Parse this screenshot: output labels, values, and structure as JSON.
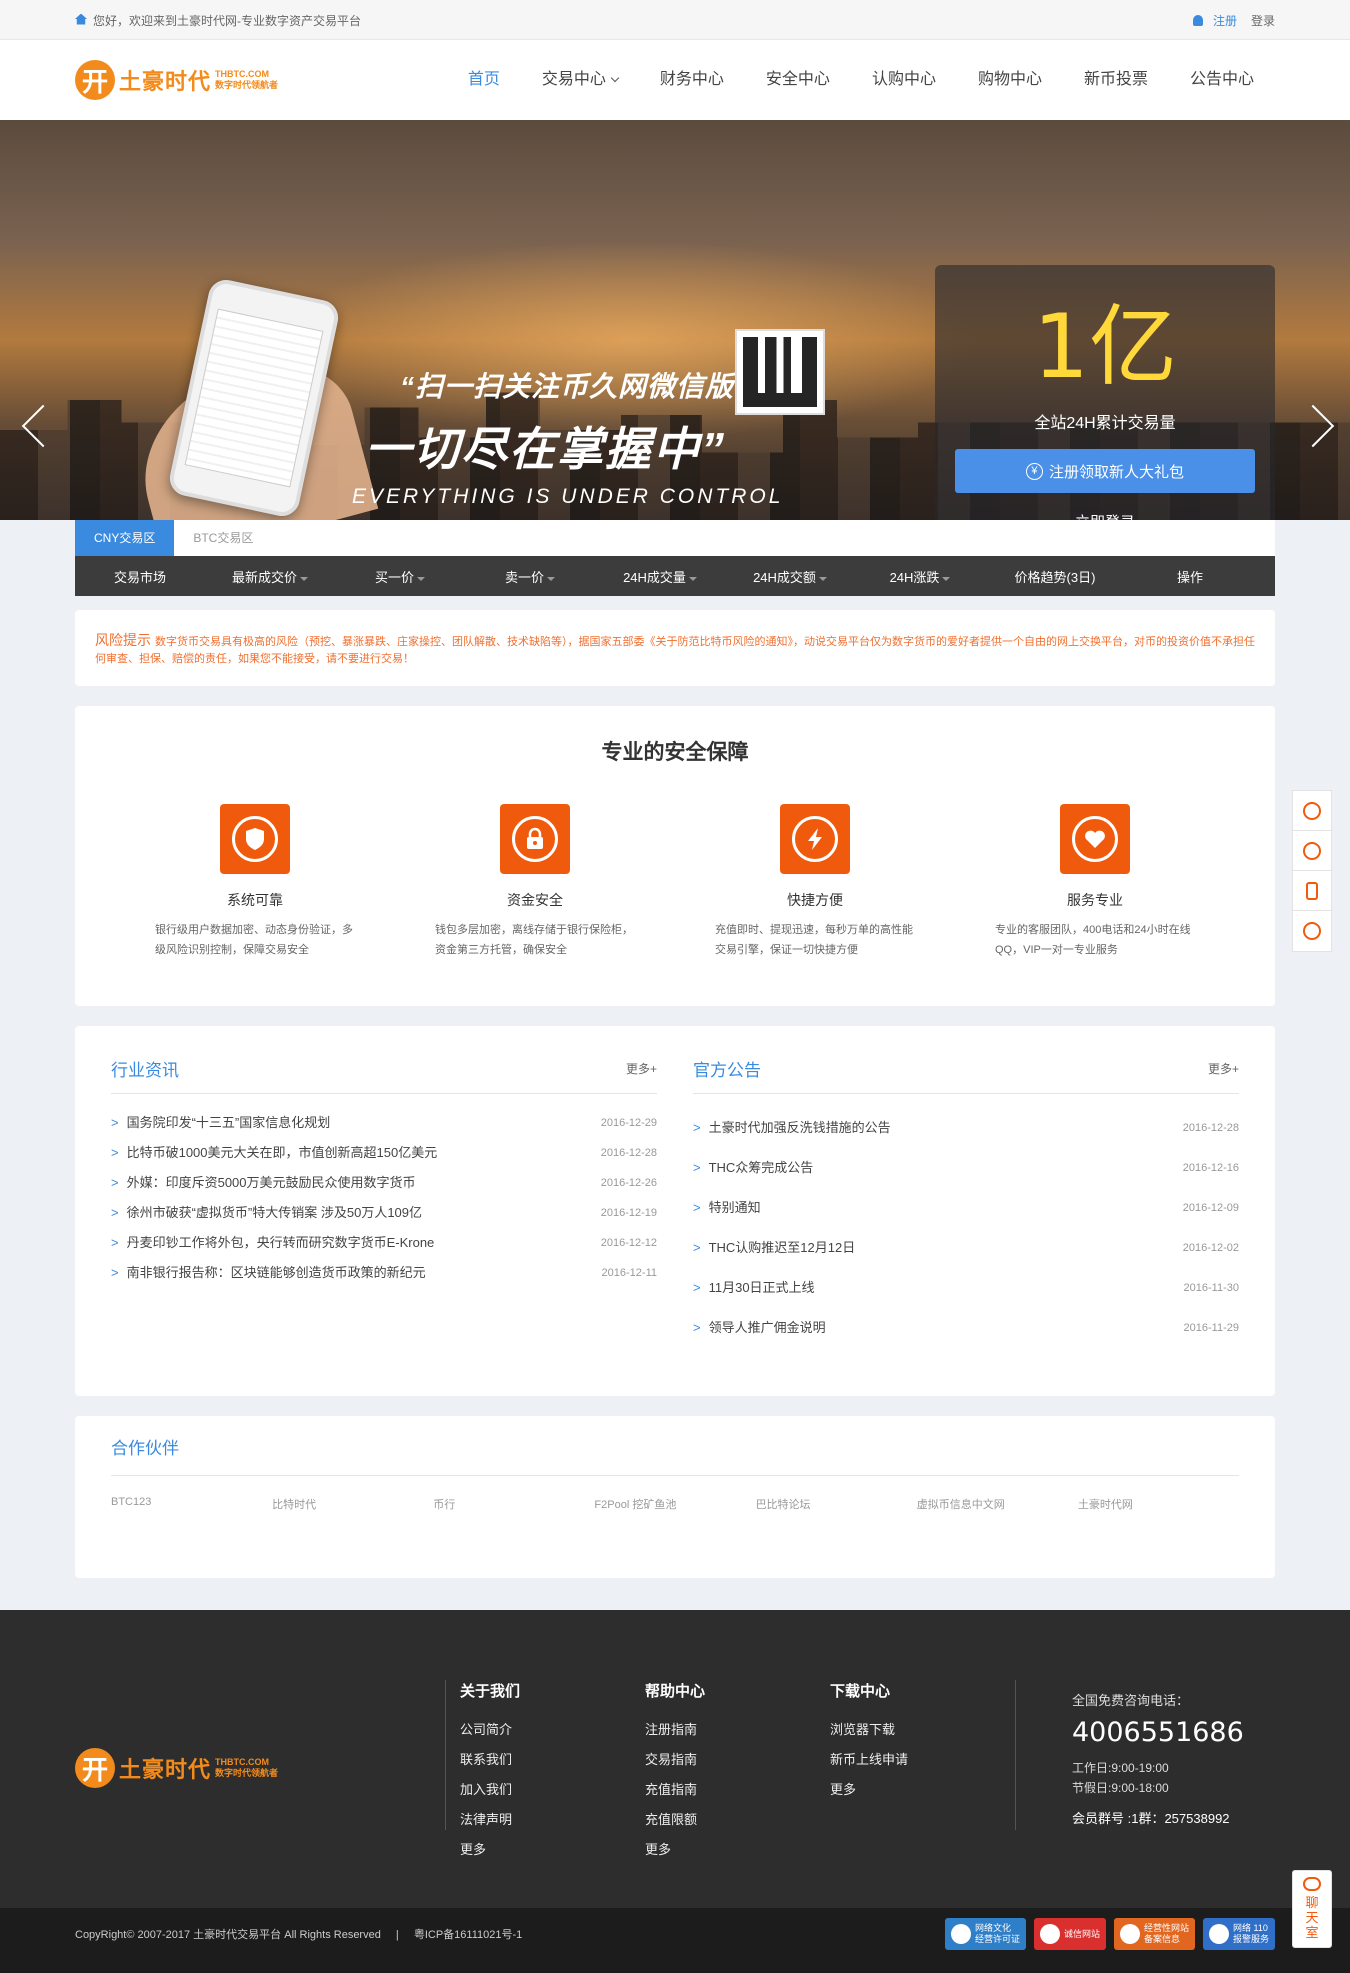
{
  "topbar": {
    "welcome": "您好，欢迎来到土豪时代网-专业数字资产交易平台",
    "register": "注册",
    "login": "登录"
  },
  "logo": {
    "mark": "开",
    "name": "土豪时代",
    "domain": "THBTC.COM",
    "tagline": "数字时代领航者"
  },
  "nav": [
    {
      "label": "首页",
      "active": true
    },
    {
      "label": "交易中心",
      "dropdown": true
    },
    {
      "label": "财务中心"
    },
    {
      "label": "安全中心"
    },
    {
      "label": "认购中心"
    },
    {
      "label": "购物中心"
    },
    {
      "label": "新币投票"
    },
    {
      "label": "公告中心"
    }
  ],
  "banner": {
    "line1": "“扫一扫关注币久网微信版",
    "line2": "一切尽在掌握中”",
    "line3": "EVERYTHING IS UNDER CONTROL",
    "volume": "1亿",
    "volume_label": "全站24H累计交易量",
    "cta": "注册领取新人大礼包",
    "yen": "¥",
    "login": "立即登录"
  },
  "market": {
    "tabs": [
      "CNY交易区",
      "BTC交易区"
    ],
    "columns": [
      "交易市场",
      "最新成交价",
      "买一价",
      "卖一价",
      "24H成交量",
      "24H成交额",
      "24H涨跌",
      "价格趋势(3日)",
      "操作"
    ]
  },
  "risk": {
    "title": "风险提示",
    "text": "数字货币交易具有极高的风险（预挖、暴涨暴跌、庄家操控、团队解散、技术缺陷等），据国家五部委《关于防范比特币风险的通知》，动说交易平台仅为数字货币的爱好者提供一个自由的网上交换平台，对币的投资价值不承担任何审查、担保、赔偿的责任，如果您不能接受，请不要进行交易！"
  },
  "security": {
    "title": "专业的安全保障",
    "features": [
      {
        "icon": "shield-icon",
        "title": "系统可靠",
        "desc": "银行级用户数据加密、动态身份验证，多级风险识别控制，保障交易安全"
      },
      {
        "icon": "lock-icon",
        "title": "资金安全",
        "desc": "钱包多层加密，离线存储于银行保险柜，资金第三方托管，确保安全"
      },
      {
        "icon": "lightning-icon",
        "title": "快捷方便",
        "desc": "充值即时、提现迅速，每秒万单的高性能交易引擎，保证一切快捷方便"
      },
      {
        "icon": "heart-icon",
        "title": "服务专业",
        "desc": "专业的客服团队，400电话和24小时在线QQ，VIP一对一专业服务"
      }
    ]
  },
  "news": {
    "title": "行业资讯",
    "more": "更多+",
    "items": [
      {
        "text": "国务院印发“十三五”国家信息化规划",
        "date": "2016-12-29"
      },
      {
        "text": "比特币破1000美元大关在即，市值创新高超150亿美元",
        "date": "2016-12-28"
      },
      {
        "text": "外媒：印度斥资5000万美元鼓励民众使用数字货币",
        "date": "2016-12-26"
      },
      {
        "text": "徐州市破获“虚拟货币”特大传销案 涉及50万人109亿",
        "date": "2016-12-19"
      },
      {
        "text": "丹麦印钞工作将外包，央行转而研究数字货币E-Krone",
        "date": "2016-12-12"
      },
      {
        "text": "南非银行报告称：区块链能够创造货币政策的新纪元",
        "date": "2016-12-11"
      }
    ]
  },
  "announcements": {
    "title": "官方公告",
    "more": "更多+",
    "items": [
      {
        "text": "土豪时代加强反洗钱措施的公告",
        "date": "2016-12-28"
      },
      {
        "text": "THC众筹完成公告",
        "date": "2016-12-16"
      },
      {
        "text": "特别通知",
        "date": "2016-12-09"
      },
      {
        "text": "THC认购推迟至12月12日",
        "date": "2016-12-02"
      },
      {
        "text": "11月30日正式上线",
        "date": "2016-11-30"
      },
      {
        "text": "领导人推广佣金说明",
        "date": "2016-11-29"
      }
    ]
  },
  "partners": {
    "title": "合作伙伴",
    "items": [
      "BTC123",
      "比特时代",
      "币行",
      "F2Pool 挖矿鱼池",
      "巴比特论坛",
      "虚拟币信息中文网",
      "土豪时代网"
    ]
  },
  "footer": {
    "cols": [
      {
        "title": "关于我们",
        "items": [
          "公司简介",
          "联系我们",
          "加入我们",
          "法律声明",
          "更多"
        ]
      },
      {
        "title": "帮助中心",
        "items": [
          "注册指南",
          "交易指南",
          "充值指南",
          "充值限额",
          "更多"
        ]
      },
      {
        "title": "下载中心",
        "items": [
          "浏览器下载",
          "新币上线申请",
          "更多"
        ]
      }
    ],
    "hotline_label": "全国免费咨询电话：",
    "hotline": "4006551686",
    "workday": "工作日:9:00-19:00",
    "holiday": "节假日:9:00-18:00",
    "qq": "会员群号 :1群：257538992",
    "copyright": "CopyRight© 2007-2017 土豪时代交易平台 All Rights Reserved",
    "sep": "|",
    "icp": "粤ICP备16111021号-1",
    "badges": [
      {
        "line1": "网络文化",
        "line2": "经营许可证",
        "color": "#2f7fc8"
      },
      {
        "line1": "诚信网站",
        "line2": "",
        "color": "#d9302f"
      },
      {
        "line1": "经营性网站",
        "line2": "备案信息",
        "color": "#e1661f"
      },
      {
        "line1": "网络 110",
        "line2": "报警服务",
        "color": "#2f6fc8"
      }
    ]
  },
  "chat": {
    "label": "聊天室"
  }
}
